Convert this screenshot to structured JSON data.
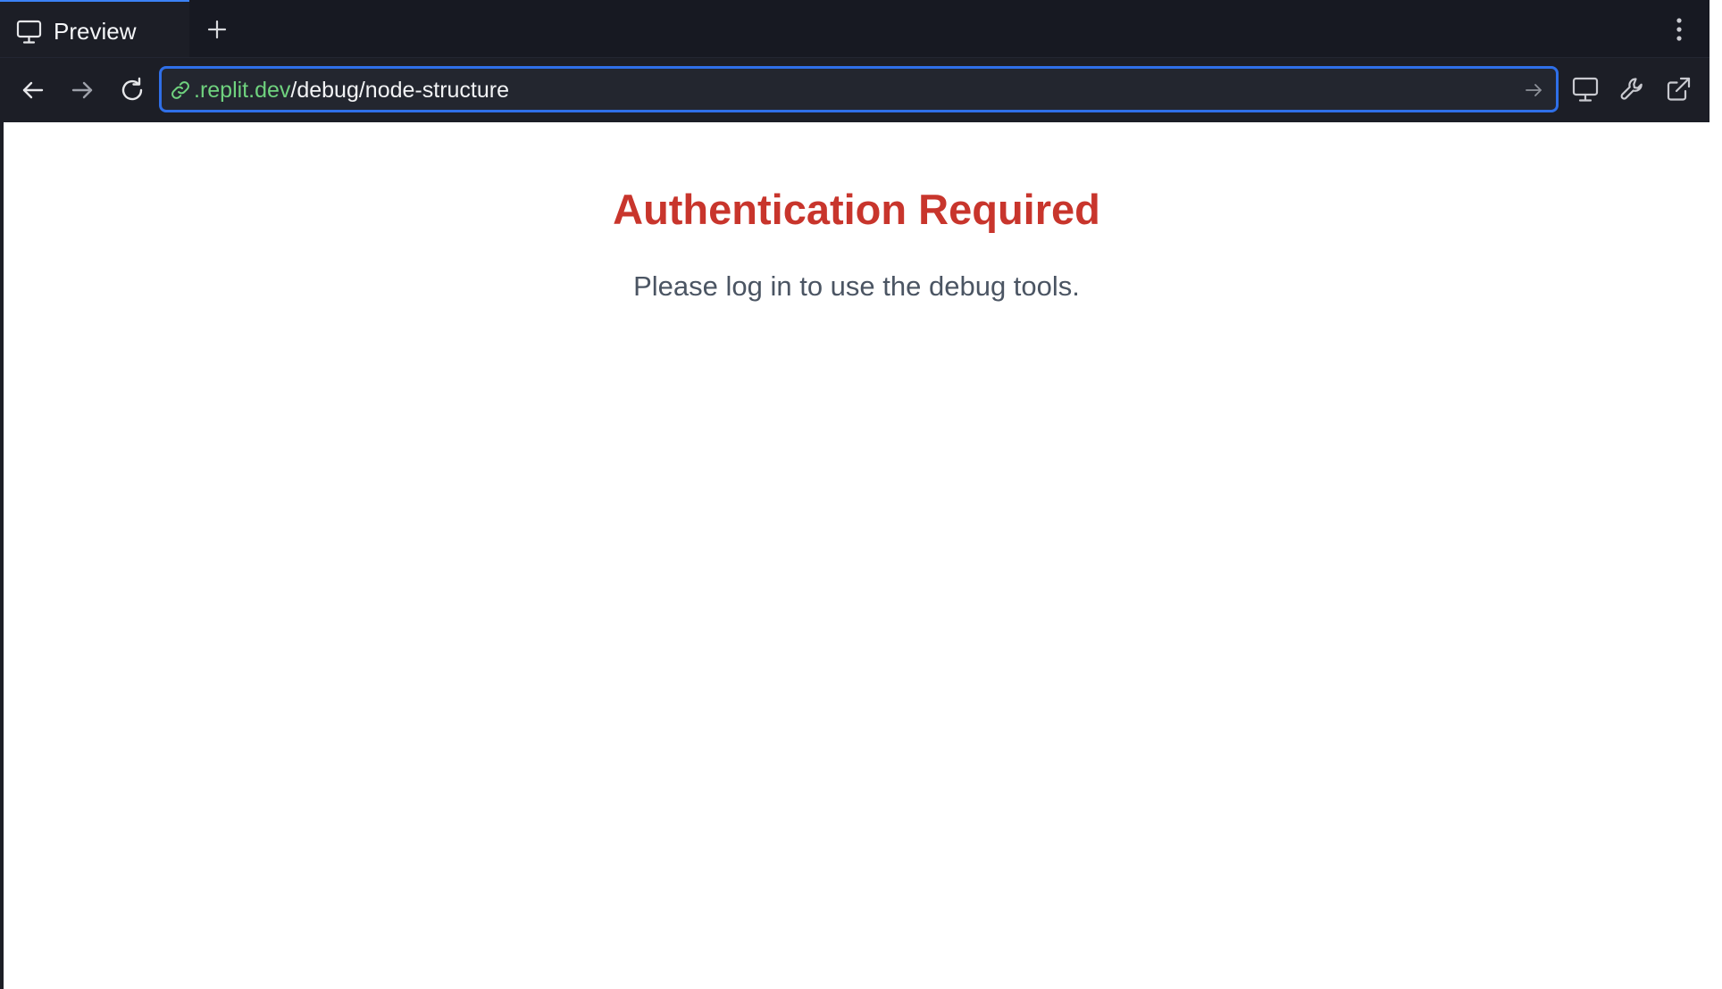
{
  "tabs": [
    {
      "label": "Preview",
      "icon": "monitor-icon",
      "active": true
    }
  ],
  "address_bar": {
    "url_host": ".replit.dev",
    "url_path": "/debug/node-structure",
    "icon": "link-icon"
  },
  "toolbar": {
    "back_icon": "arrow-left-icon",
    "forward_icon": "arrow-right-icon",
    "reload_icon": "reload-icon",
    "go_icon": "arrow-right-icon",
    "devices_icon": "monitor-icon",
    "devtools_icon": "wrench-icon",
    "open_external_icon": "external-link-icon",
    "menu_icon": "kebab-menu-icon",
    "new_tab_icon": "plus-icon"
  },
  "page": {
    "title": "Authentication Required",
    "message": "Please log in to use the debug tools."
  },
  "colors": {
    "chrome_background": "#1c1e26",
    "focus_ring": "#2f6fe8",
    "url_host": "#6fd27e",
    "title_red": "#c8352c",
    "message_gray": "#4b5563"
  }
}
